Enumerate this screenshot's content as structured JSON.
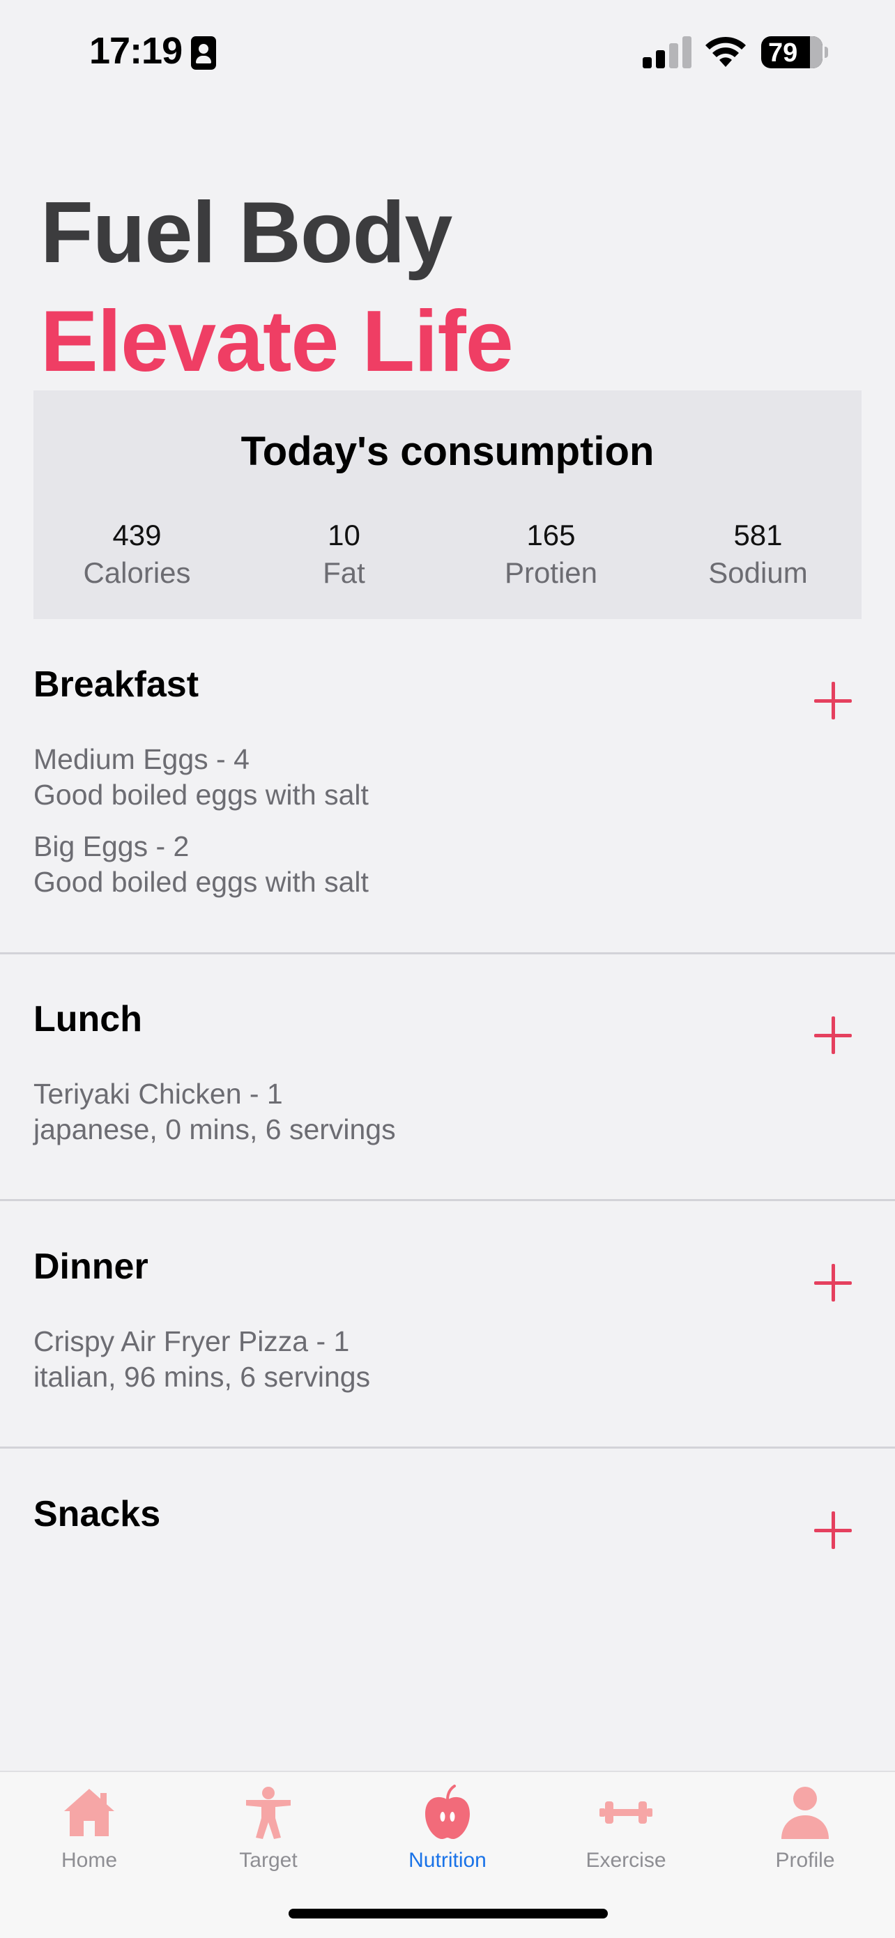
{
  "status_bar": {
    "time": "17:19",
    "battery": "79"
  },
  "hero": {
    "line1": "Fuel Body",
    "line2_word1": "Elevate",
    "line2_word2": "Life"
  },
  "consumption": {
    "title": "Today's consumption",
    "metrics": [
      {
        "value": "439",
        "label": "Calories"
      },
      {
        "value": "10",
        "label": "Fat"
      },
      {
        "value": "165",
        "label": "Protien"
      },
      {
        "value": "581",
        "label": "Sodium"
      }
    ]
  },
  "meals": [
    {
      "title": "Breakfast",
      "items": [
        {
          "name": "Medium Eggs - 4",
          "desc": "Good boiled eggs with salt"
        },
        {
          "name": "Big Eggs - 2",
          "desc": "Good boiled eggs with salt"
        }
      ]
    },
    {
      "title": "Lunch",
      "items": [
        {
          "name": "Teriyaki Chicken - 1",
          "desc": "japanese, 0 mins,  6 servings"
        }
      ]
    },
    {
      "title": "Dinner",
      "items": [
        {
          "name": "Crispy Air Fryer Pizza - 1",
          "desc": "italian, 96 mins,  6 servings"
        }
      ]
    },
    {
      "title": "Snacks",
      "items": []
    }
  ],
  "tabs": [
    {
      "label": "Home",
      "icon": "house-icon"
    },
    {
      "label": "Target",
      "icon": "person-stretch-icon"
    },
    {
      "label": "Nutrition",
      "icon": "apple-icon",
      "active": true
    },
    {
      "label": "Exercise",
      "icon": "dumbbell-icon"
    },
    {
      "label": "Profile",
      "icon": "person-icon"
    }
  ],
  "colors": {
    "accent": "#ef3e64",
    "tab_icon": "#f6a6a6",
    "tab_active_label": "#1a73e8",
    "background": "#f2f2f4",
    "card": "#e6e6ea"
  }
}
